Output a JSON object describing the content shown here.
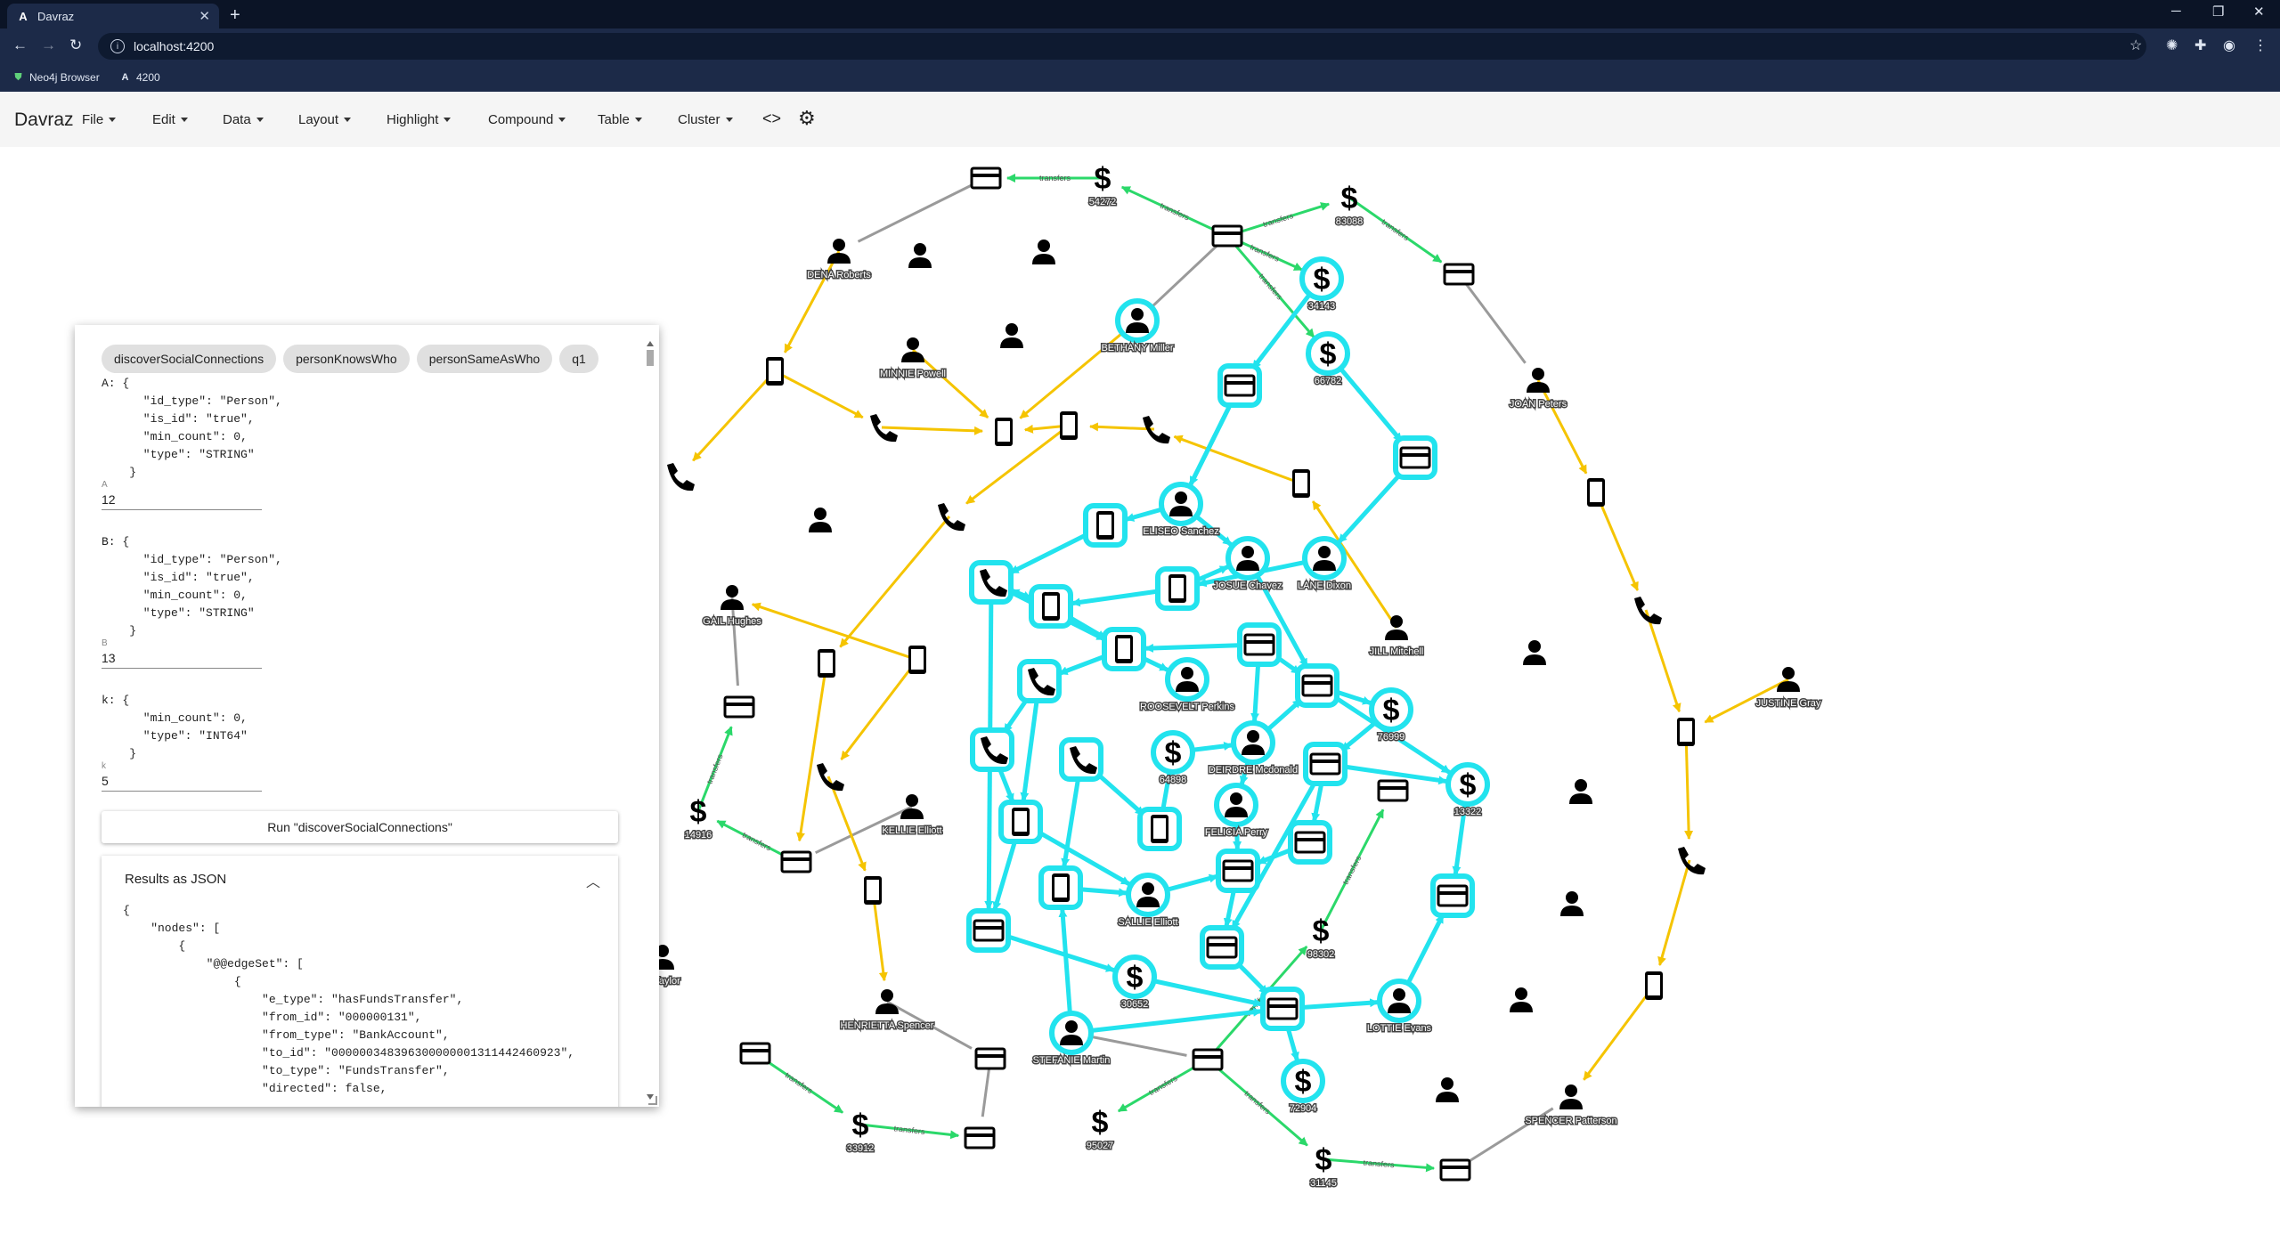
{
  "browser": {
    "tab_title": "Davraz",
    "tab_favicon": "A",
    "url": "localhost:4200",
    "bookmarks": [
      {
        "label": "Neo4j Browser",
        "icon": "neo4j-shield-icon"
      },
      {
        "label": "4200",
        "icon": "A"
      }
    ]
  },
  "app": {
    "brand": "Davraz",
    "menus": [
      {
        "label": "File"
      },
      {
        "label": "Edit"
      },
      {
        "label": "Data"
      },
      {
        "label": "Layout"
      },
      {
        "label": "Highlight"
      },
      {
        "label": "Compound"
      },
      {
        "label": "Table"
      },
      {
        "label": "Cluster"
      }
    ],
    "code_icon": "<>",
    "settings_icon": "gear-icon"
  },
  "panel": {
    "chips": [
      "discoverSocialConnections",
      "personKnowsWho",
      "personSameAsWho",
      "q1"
    ],
    "param_a_text": "A: {\n      \"id_type\": \"Person\",\n      \"is_id\": \"true\",\n      \"min_count\": 0,\n      \"type\": \"STRING\"\n    }",
    "param_a_label": "A",
    "param_a_value": "12",
    "param_b_text": "B: {\n      \"id_type\": \"Person\",\n      \"is_id\": \"true\",\n      \"min_count\": 0,\n      \"type\": \"STRING\"\n    }",
    "param_b_label": "B",
    "param_b_value": "13",
    "param_k_text": "k: {\n      \"min_count\": 0,\n      \"type\": \"INT64\"\n    }",
    "param_k_label": "k",
    "param_k_value": "5",
    "run_label": "Run \"discoverSocialConnections\"",
    "results_title": "Results as JSON",
    "results_json": "{\n    \"nodes\": [\n        {\n            \"@@edgeSet\": [\n                {\n                    \"e_type\": \"hasFundsTransfer\",\n                    \"from_id\": \"000000131\",\n                    \"from_type\": \"BankAccount\",\n                    \"to_id\": \"000000348396300000001311442460923\",\n                    \"to_type\": \"FundsTransfer\",\n                    \"directed\": false,"
  },
  "graph": {
    "colors": {
      "highlight": "#22e3ee",
      "transfer_edge": "#2bd86a",
      "phone_edge": "#f5c400",
      "plain_edge": "#9a9a9a"
    },
    "edge_label": "transfers",
    "person_labels": {
      "dena": "DENA Roberts",
      "bethany": "BETHANY Miller",
      "minnie": "MINNIE Powell",
      "joan": "JOAN Peters",
      "eliseo": "ELISEO Sanchez",
      "josue": "JOSUE Chavez",
      "lane": "LANE Dixon",
      "jill": "JILL Mitchell",
      "gail": "GAIL Hughes",
      "roosevelt": "ROOSEVELT Perkins",
      "deirdre": "DEIRDRE Mcdonald",
      "felicia": "FELICIA Perry",
      "justine": "JUSTINE Gray",
      "kellie": "KELLIE Elliott",
      "sallie": "SALLIE Elliott",
      "henrietta": "HENRIETTA Spencer",
      "stefanie": "STEFANIE Martin",
      "lottie": "LOTTIE Evans",
      "spencer": "SPENCER Patterson",
      "etaylor": "E Taylor"
    },
    "amount_labels": {
      "t54272": "54272",
      "t83088": "83088",
      "t34143": "34143",
      "t66782": "66782",
      "t76999": "76999",
      "t64898": "64898",
      "t13322": "13322",
      "t14916": "14916",
      "t98302": "98302",
      "t30652": "30652",
      "t72904": "72904",
      "t95027": "95027",
      "t33912": "33912",
      "t31145": "31145"
    }
  }
}
